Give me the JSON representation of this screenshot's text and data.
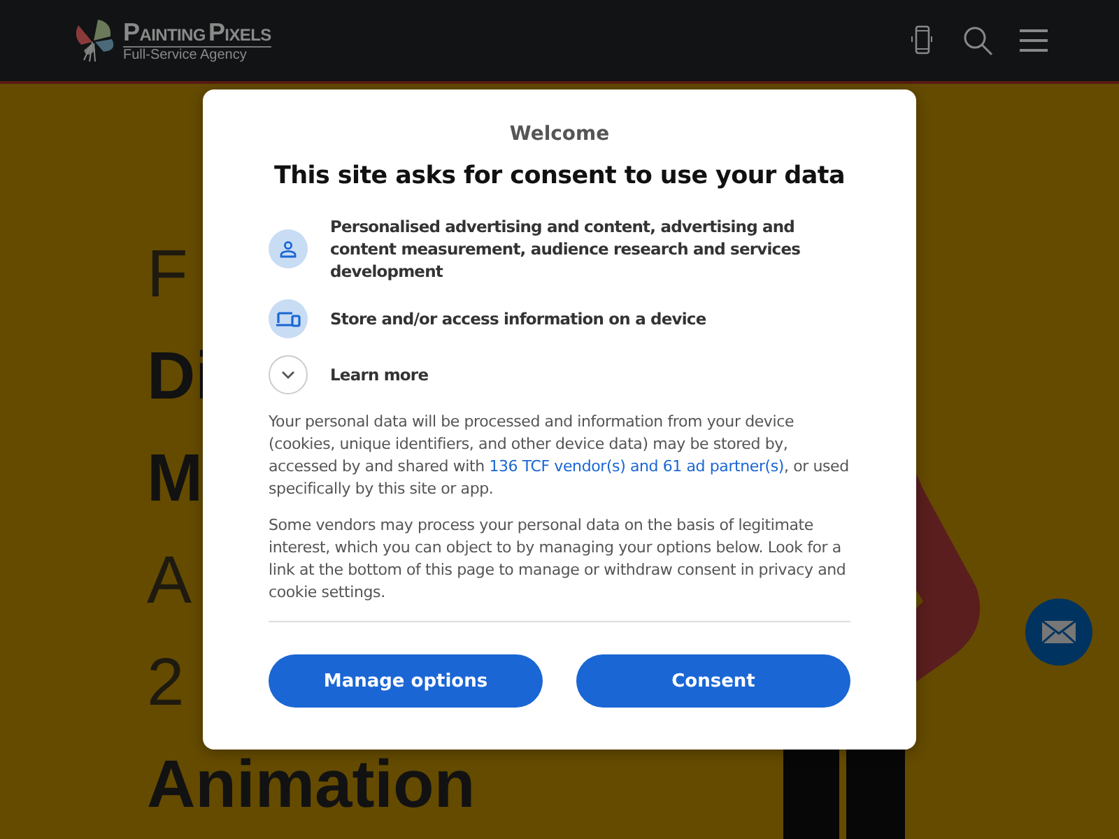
{
  "header": {
    "logo": {
      "words": [
        "PAINTING",
        "PIXELS"
      ],
      "tagline": "Full-Service Agency"
    }
  },
  "hero": {
    "lines": [
      {
        "text": "F",
        "bold": false
      },
      {
        "text": "Di",
        "bold": true
      },
      {
        "text": "M",
        "bold": true
      },
      {
        "text": "A",
        "bold": false
      },
      {
        "text": "2",
        "bold": false
      },
      {
        "text": "Animation",
        "bold": true
      }
    ]
  },
  "consent": {
    "welcome": "Welcome",
    "title": "This site asks for consent to use your data",
    "purposes": [
      {
        "kind": "person",
        "text": "Personalised advertising and content, advertising and content measurement, audience research and services development"
      },
      {
        "kind": "device",
        "text": "Store and/or access information on a device"
      },
      {
        "kind": "expand",
        "text": "Learn more"
      }
    ],
    "paragraph_1": {
      "before": "Your personal data will be processed and information from your device (cookies, unique identifiers, and other device data) may be stored by, accessed by and shared with ",
      "link": "136 TCF vendor(s) and 61 ad partner(s)",
      "after": ", or used specifically by this site or app."
    },
    "paragraph_2": "Some vendors may process your personal data on the basis of legitimate interest, which you can object to by managing your options below. Look for a link at the bottom of this page to manage or withdraw consent in privacy and cookie settings.",
    "buttons": [
      "Manage options",
      "Consent"
    ]
  }
}
